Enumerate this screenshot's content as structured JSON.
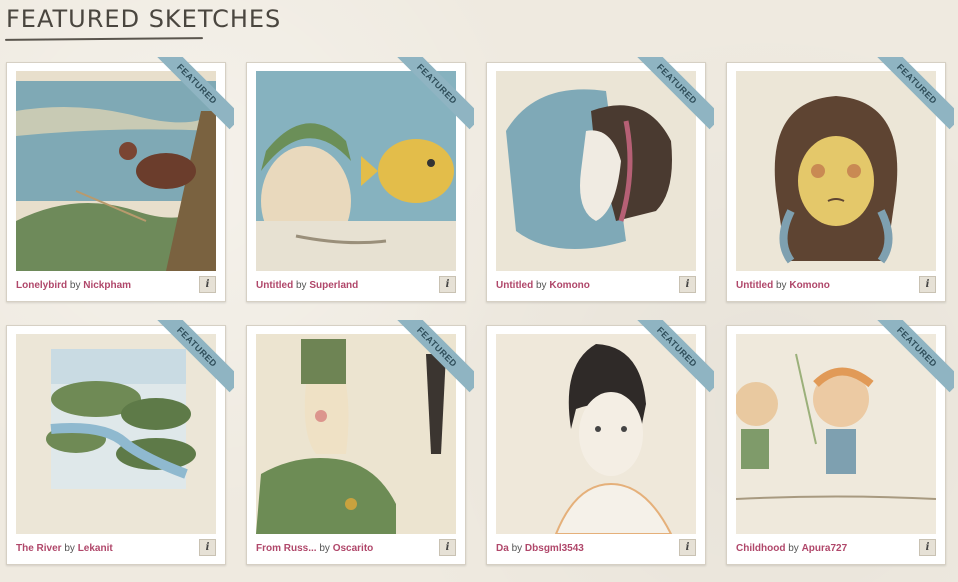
{
  "page": {
    "title": "FEATURED SKETCHES",
    "ribbon_label": "FEATURED",
    "by_word": "by",
    "info_label": "i"
  },
  "sketches": [
    {
      "title": "Lonelybird",
      "artist": "Nickpham"
    },
    {
      "title": "Untitled",
      "artist": "Superland"
    },
    {
      "title": "Untitled",
      "artist": "Komono"
    },
    {
      "title": "Untitled",
      "artist": "Komono"
    },
    {
      "title": "The River",
      "artist": "Lekanit"
    },
    {
      "title": "From Russ...",
      "artist": "Oscarito"
    },
    {
      "title": "Da",
      "artist": "Dbsgml3543"
    },
    {
      "title": "Childhood",
      "artist": "Apura727"
    }
  ],
  "colors": {
    "background": "#efeae0",
    "link": "#b0476a",
    "ribbon": "#8fb4c2"
  }
}
